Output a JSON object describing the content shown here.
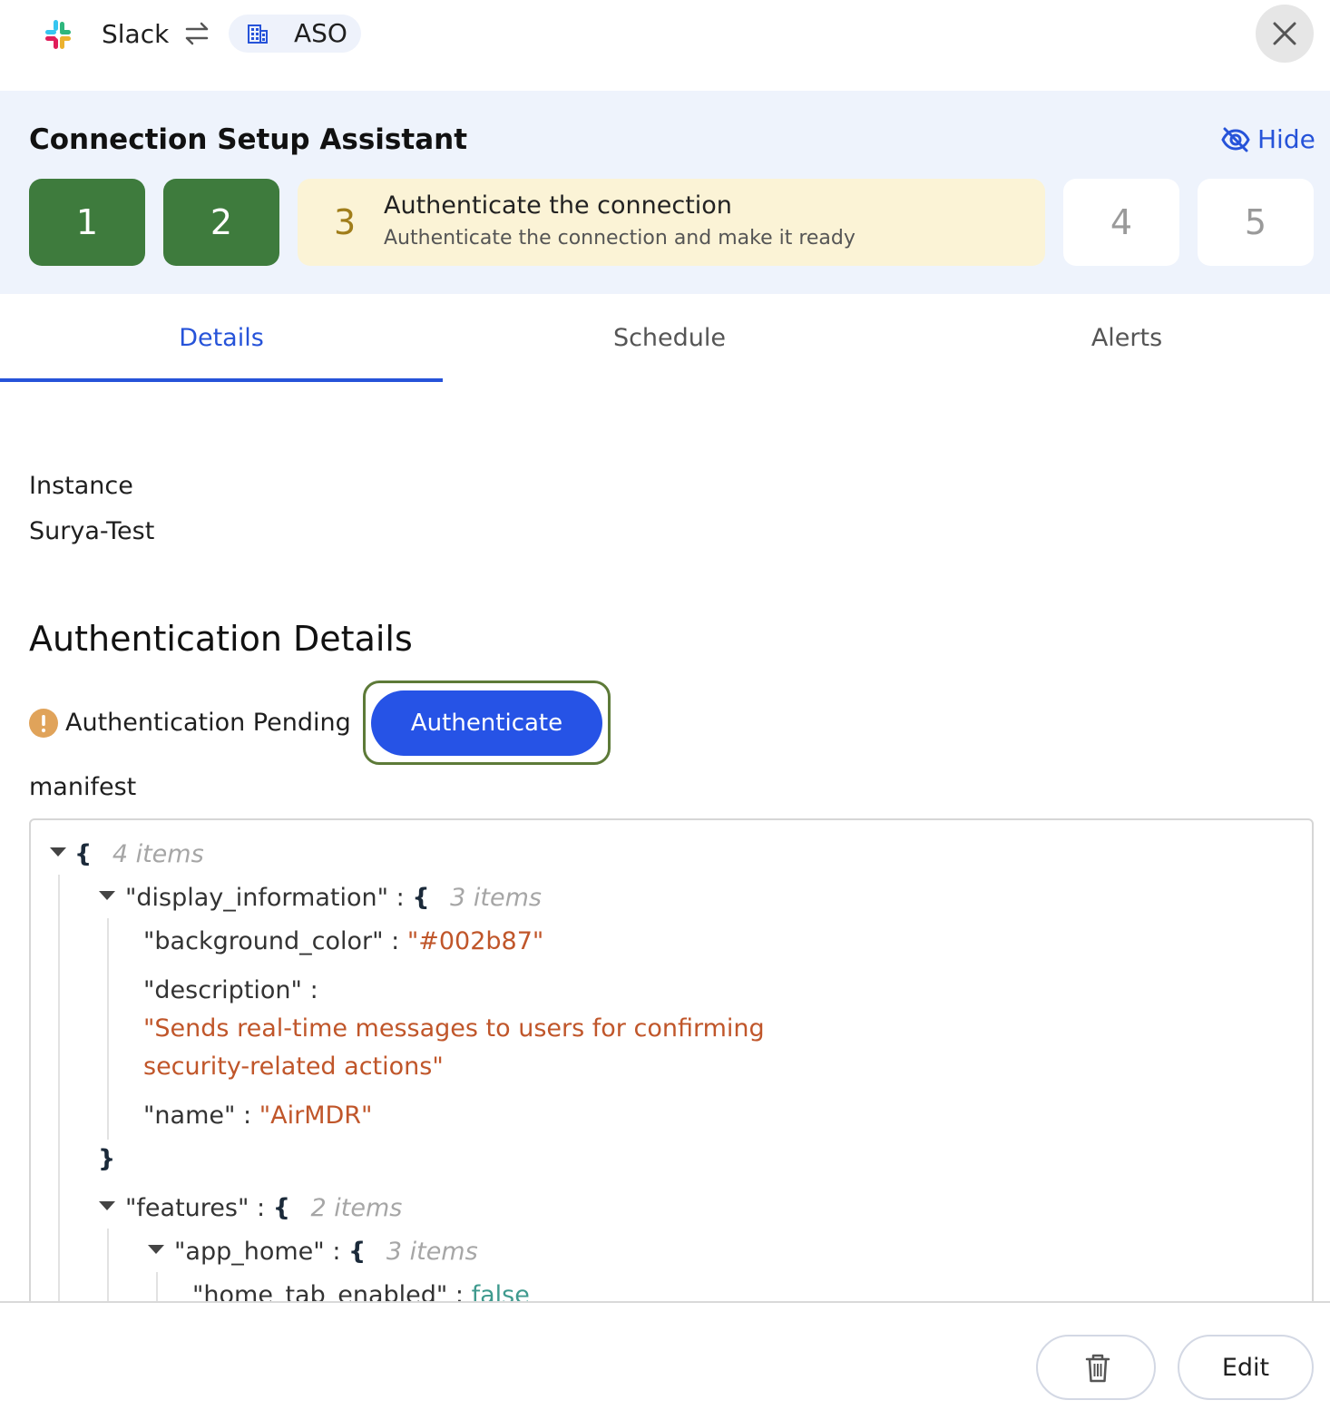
{
  "header": {
    "app_name": "Slack",
    "app_icon": "slack-logo",
    "link_icon": "swap-arrows-icon",
    "org_icon": "building-icon",
    "org_name": "ASO",
    "close_icon": "close-icon"
  },
  "assistant": {
    "title": "Connection Setup Assistant",
    "hide_label": "Hide",
    "hide_icon": "eye-off-icon",
    "steps": [
      {
        "number": "1",
        "status": "completed"
      },
      {
        "number": "2",
        "status": "completed"
      },
      {
        "number": "3",
        "status": "current",
        "title": "Authenticate the connection",
        "subtitle": "Authenticate the connection and make it ready"
      },
      {
        "number": "4",
        "status": "pending"
      },
      {
        "number": "5",
        "status": "pending"
      }
    ],
    "colors": {
      "completed": "#3e7b3d",
      "current": "#fbf3d6",
      "pending": "#ffffff"
    }
  },
  "tabs": [
    {
      "label": "Details",
      "active": true
    },
    {
      "label": "Schedule",
      "active": false
    },
    {
      "label": "Alerts",
      "active": false
    }
  ],
  "details": {
    "instance_label": "Instance",
    "instance_value": "Surya-Test",
    "auth_section_title": "Authentication Details",
    "auth_status": "Authentication Pending",
    "auth_status_icon": "warning-icon",
    "authenticate_button": "Authenticate",
    "manifest_label": "manifest"
  },
  "manifest": {
    "root_brace": "{",
    "root_count": "4 items",
    "display_information_key": "\"display_information\"",
    "display_information_count": "3 items",
    "background_color_key": "\"background_color\"",
    "background_color_value": "\"#002b87\"",
    "description_key": "\"description\"",
    "description_value_line1": "\"Sends real-time messages to users for confirming",
    "description_value_line2": "security-related actions\"",
    "name_key": "\"name\"",
    "name_value": "\"AirMDR\"",
    "close_brace": "}",
    "features_key": "\"features\"",
    "features_count": "2 items",
    "app_home_key": "\"app_home\"",
    "app_home_count": "3 items",
    "home_tab_enabled_key": "\"home_tab_enabled\"",
    "home_tab_enabled_value": "false",
    "colon": ":",
    "open_brace": "{"
  },
  "footer": {
    "delete_icon": "trash-icon",
    "edit_label": "Edit"
  },
  "colors": {
    "accent": "#2653d9",
    "string_value": "#c0562a",
    "boolean_value": "#3f9a8e",
    "warning": "#e0a35a"
  }
}
